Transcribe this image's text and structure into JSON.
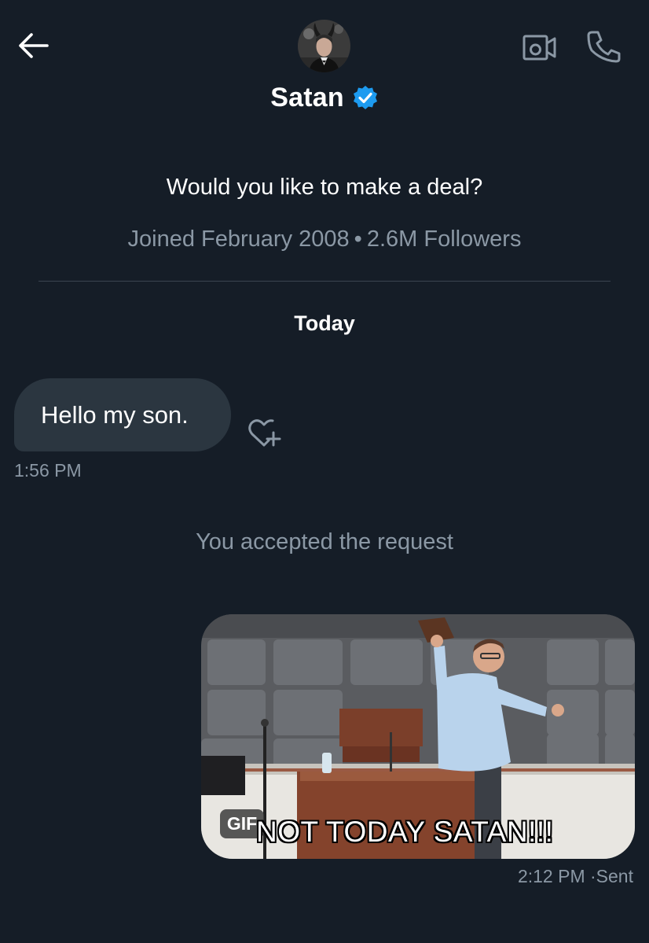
{
  "header": {
    "back_icon": "arrow-left-icon",
    "video_icon": "video-camera-icon",
    "phone_icon": "phone-icon",
    "contact_name": "Satan",
    "verified_icon": "verified-badge-icon",
    "verified_color": "#1d9bf0"
  },
  "profile": {
    "bio": "Would you like to make a deal?",
    "joined": "Joined February 2008",
    "separator": "•",
    "followers": "2.6M Followers"
  },
  "conversation": {
    "day_label": "Today",
    "messages": [
      {
        "direction": "received",
        "text": "Hello my son.",
        "time": "1:56 PM",
        "reaction_icon": "add-reaction-heart-icon"
      },
      {
        "direction": "sent",
        "type": "gif",
        "gif_badge": "GIF",
        "gif_caption": "NOT TODAY SATAN!!!",
        "time": "2:12 PM",
        "status": "Sent"
      }
    ],
    "system_message": "You accepted the request"
  },
  "colors": {
    "background": "#151d27",
    "bubble_received": "#2b3640",
    "muted_text": "#8b98a5",
    "accent": "#1d9bf0"
  }
}
